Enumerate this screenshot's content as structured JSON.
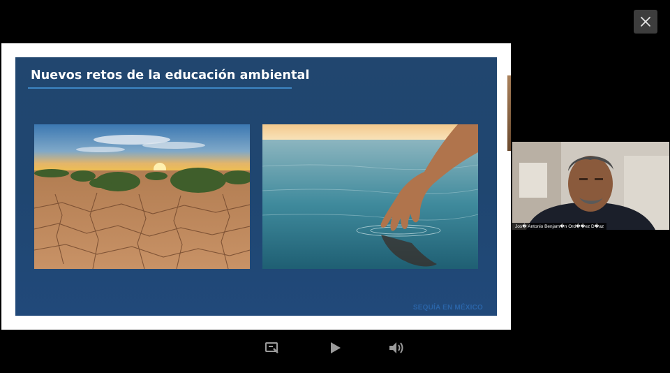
{
  "viewer": {
    "close_icon": "close-icon",
    "colors": {
      "background": "#000000",
      "button_bg": "#3d3d3d",
      "icon": "#9a9a9a"
    }
  },
  "slide": {
    "title": "Nuevos retos de la educación ambiental",
    "footer": "SEQUÍA EN MÉXICO",
    "colors": {
      "panel": "#1f4670",
      "title_rule": "#3d86c4",
      "footer_text": "#2a64a7"
    },
    "images": [
      {
        "id": "desert",
        "subject": "cracked dry soil at sunset"
      },
      {
        "id": "water",
        "subject": "hand touching calm water"
      }
    ]
  },
  "participant": {
    "name": "Jos� Antonio Benjam�n Ord��ez D�az"
  },
  "controls": {
    "icons": [
      "captions-icon",
      "play-icon",
      "volume-icon"
    ]
  }
}
